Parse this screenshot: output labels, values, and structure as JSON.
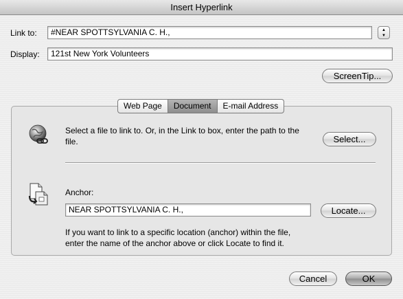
{
  "window": {
    "title": "Insert Hyperlink"
  },
  "link_to": {
    "label": "Link to:",
    "value": "#NEAR SPOTTSYLVANIA C. H.,"
  },
  "display": {
    "label": "Display:",
    "value": "121st New York Volunteers"
  },
  "buttons": {
    "screentip": "ScreenTip...",
    "select": "Select...",
    "locate": "Locate...",
    "cancel": "Cancel",
    "ok": "OK"
  },
  "tabs": [
    "Web Page",
    "Document",
    "E-mail Address"
  ],
  "active_tab": "Document",
  "document_panel": {
    "select_text_line1": "Select a file to link to. Or, in the Link to box, enter the path to the",
    "select_text_line2": "file.",
    "anchor_label": "Anchor:",
    "anchor_value": "NEAR SPOTTSYLVANIA C. H.,",
    "help_text_line1": "If you want to link to a specific location (anchor) within the file,",
    "help_text_line2": "enter the name of the anchor above or click Locate to find it."
  },
  "icons": {
    "stepper": "updown-arrows-icon",
    "document_link": "globe-link-icon",
    "anchor": "document-anchor-icon"
  }
}
